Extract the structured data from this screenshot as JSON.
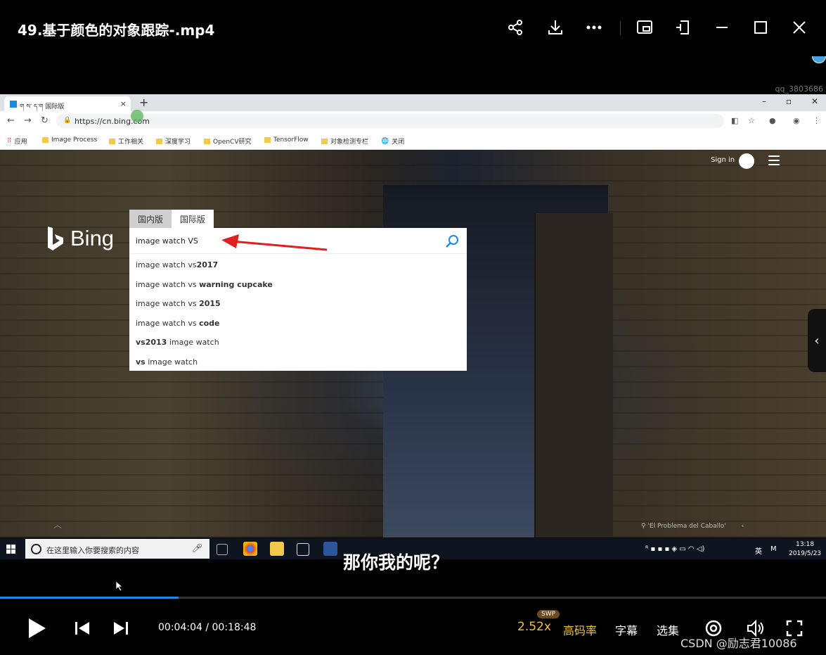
{
  "player": {
    "title": "49.基于颜色的对象跟踪-.mp4",
    "overlay_id": "qq_3803686",
    "current_time": "00:04:04",
    "total_time": "00:18:48",
    "time_sep": " / ",
    "progress_fraction": 0.216,
    "speed": "2.52x",
    "speed_badge": "SWP",
    "bitrate_label": "高码率",
    "subtitle_label": "字幕",
    "episodes_label": "选集",
    "subtitle_text": "那你我的呢？",
    "watermark": "CSDN @励志君10086"
  },
  "browser": {
    "tab_title": "ག ས་ ད་ག 国际版",
    "tab_close": "×",
    "new_tab": "+",
    "url": "https://cn.bing.com",
    "bookmarks": [
      "应用",
      "Image Process",
      "工作相关",
      "深度学习",
      "OpenCV研究",
      "TensorFlow",
      "对象检测专栏",
      "关闭"
    ]
  },
  "bing": {
    "logo_text": "Bing",
    "sign_in": "Sign in",
    "tab_domestic": "国内版",
    "tab_international": "国际版",
    "search_value": "image watch VS",
    "suggestions": [
      {
        "normal": "image watch vs",
        "bold": "2017",
        "bold_first": false
      },
      {
        "normal": "image watch vs ",
        "bold": "warning cupcake",
        "bold_first": false
      },
      {
        "normal": "image watch vs ",
        "bold": "2015",
        "bold_first": false
      },
      {
        "normal": "image watch vs ",
        "bold": "code",
        "bold_first": false
      },
      {
        "normal": " image watch",
        "bold": "vs2013",
        "bold_first": true
      },
      {
        "normal": " image watch",
        "bold": "vs",
        "bold_first": true
      }
    ],
    "image_credit": "'El Problema del Caballo'"
  },
  "taskbar": {
    "search_placeholder": "在这里输入你要搜索的内容",
    "ime": "英",
    "time": "13:18",
    "date": "2019/5/23"
  },
  "colors": {
    "accent_blue": "#1e88e5",
    "gold": "#f0c040",
    "arrow_red": "#e02020"
  }
}
